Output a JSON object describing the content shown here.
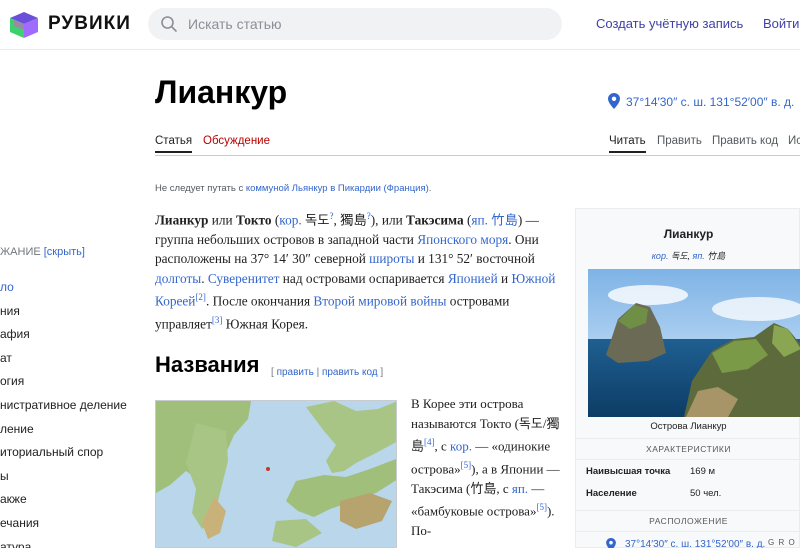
{
  "header": {
    "brand": "РУВИКИ",
    "search_placeholder": "Искать статью",
    "create_account": "Создать учётную запись",
    "login": "Войти"
  },
  "toc": {
    "heading": "ЖАНИЕ",
    "hide_label": "[скрыть]",
    "items": [
      {
        "label": "ло",
        "active": true
      },
      {
        "label": "ния"
      },
      {
        "label": "афия"
      },
      {
        "label": "ат"
      },
      {
        "label": "огия"
      },
      {
        "label": "нистративное деление"
      },
      {
        "label": "ление"
      },
      {
        "label": "иториальный спор"
      },
      {
        "label": "ы"
      },
      {
        "label": "акже"
      },
      {
        "label": "ечания"
      },
      {
        "label": "атура"
      }
    ]
  },
  "page": {
    "title": "Лианкур",
    "coordinates": "37°14′30″ с. ш. 131°52′00″ в. д.",
    "tabs": {
      "article": "Статья",
      "discussion": "Обсуждение",
      "read": "Читать",
      "edit": "Править",
      "edit_source": "Править код",
      "history": "Ис"
    },
    "hatnote": {
      "prefix": "Не следует путать с ",
      "link": "коммуной Льянкур в Пикардии (Франция)",
      "suffix": "."
    },
    "lead": {
      "t1": "Лианкур",
      "t2": " или ",
      "t3": "Токто",
      "t4": " (",
      "t5": "кор.",
      "t6": " 독도",
      "t7": "?",
      "t8": ", 獨島",
      "t9": "?",
      "t10": "), или ",
      "t11": "Такэсима",
      "t12": " (",
      "t13": "яп.",
      "t14": " 竹島",
      "t15": ") — группа небольших островов в западной части ",
      "t16": "Японского моря",
      "t17": ". Они расположены на 37° 14′ 30″ северной ",
      "t18": "широты",
      "t19": " и 131° 52′ восточной ",
      "t20": "долготы",
      "t21": ". ",
      "t22": "Суверенитет",
      "t23": " над островами оспаривается ",
      "t24": "Японией",
      "t25": " и ",
      "t26": "Южной Кореей",
      "t27": "[2]",
      "t28": ". После окончания ",
      "t29": "Второй мировой войны",
      "t30": " островами управляет",
      "t31": "[3]",
      "t32": " Южная Корея."
    },
    "section_names": {
      "heading": "Названия",
      "edit_open": "[ ",
      "edit": "править",
      "sep": " | ",
      "edit_source": "править код",
      "edit_close": " ]"
    },
    "names_para": {
      "n1": "В Корее эти острова называются Токто (독도/獨島",
      "n2": "[4]",
      "n3": ", с ",
      "n4": "кор.",
      "n5": " — «одинокие острова»",
      "n6": "[5]",
      "n7": "), а в Японии — Такэсима (竹島, с ",
      "n8": "яп.",
      "n9": " — «бамбуковые острова»",
      "n10": "[5]",
      "n11": "). По-"
    }
  },
  "infobox": {
    "title": "Лианкур",
    "sub_kor": "кор.",
    "sub_kor_text": " 독도, ",
    "sub_jap": "яп.",
    "sub_jap_text": " 竹島",
    "caption": "Острова Лианкур",
    "section_characteristics": "ХАРАКТЕРИСТИКИ",
    "rows": [
      {
        "key": "Наивысшая точка",
        "value": "169 м"
      },
      {
        "key": "Население",
        "value": "50 чел."
      }
    ],
    "section_location": "РАСПОЛОЖЕНИЕ",
    "coords": "37°14′30″ с. ш. 131°52′00″ в. д.",
    "geo": "G R O"
  },
  "colors": {
    "link": "#3366cc",
    "redlink": "#ba0000",
    "header_link": "#3f3fa8",
    "logo_green": "#3bd16f",
    "logo_purple": "#6b4fd8"
  }
}
